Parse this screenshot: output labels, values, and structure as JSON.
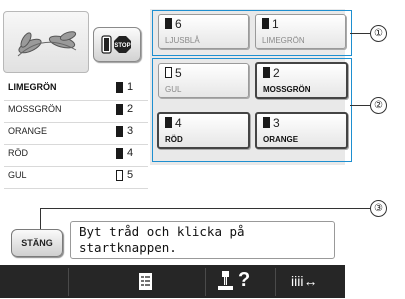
{
  "left_panel": {
    "thread_list": [
      {
        "name": "LIMEGRÖN",
        "number": "1",
        "filled": true
      },
      {
        "name": "MOSSGRÖN",
        "number": "2",
        "filled": true
      },
      {
        "name": "ORANGE",
        "number": "3",
        "filled": true
      },
      {
        "name": "RÖD",
        "number": "4",
        "filled": true
      },
      {
        "name": "GUL",
        "number": "5",
        "filled": false
      }
    ],
    "stop_label": "STOP"
  },
  "spool_grid": [
    {
      "number": "6",
      "label": "LJUSBLÅ",
      "active": false,
      "filled": true
    },
    {
      "number": "1",
      "label": "LIMEGRÖN",
      "active": false,
      "filled": true
    },
    {
      "number": "5",
      "label": "GUL",
      "active": false,
      "filled": false
    },
    {
      "number": "2",
      "label": "MOSSGRÖN",
      "active": true,
      "filled": true
    },
    {
      "number": "4",
      "label": "RÖD",
      "active": true,
      "filled": true
    },
    {
      "number": "3",
      "label": "ORANGE",
      "active": true,
      "filled": true
    }
  ],
  "callouts": [
    "①",
    "②",
    "③"
  ],
  "message": {
    "close_label": "STÄNG",
    "line1": "Byt tråd och klicka på",
    "line2": "startknappen."
  },
  "bottom_bar": {
    "help_label": "?",
    "slide_label": "iiii↔"
  },
  "colors": {
    "callout_blue": "#1e8fd0",
    "bottom_bar": "#262626"
  }
}
